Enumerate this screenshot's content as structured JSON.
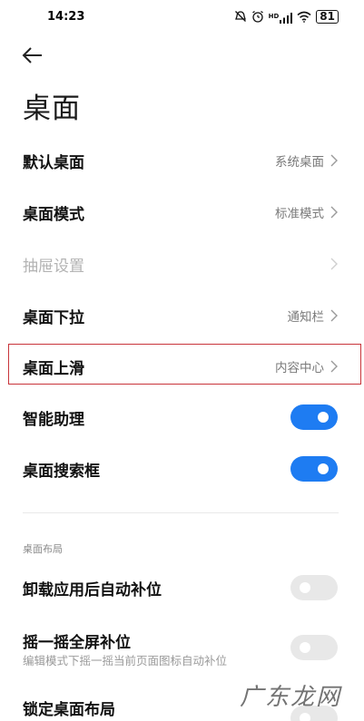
{
  "status_bar": {
    "time": "14:23",
    "icons": [
      "alarm-off-icon",
      "alarm-icon",
      "hd-signal-icon",
      "wifi-icon"
    ],
    "hd_text": "HD",
    "battery": "81"
  },
  "page": {
    "title": "桌面"
  },
  "rows": [
    {
      "label": "默认桌面",
      "value": "系统桌面"
    },
    {
      "label": "桌面模式",
      "value": "标准模式"
    },
    {
      "label": "抽屉设置",
      "value": ""
    },
    {
      "label": "桌面下拉",
      "value": "通知栏"
    },
    {
      "label": "桌面上滑",
      "value": "内容中心"
    }
  ],
  "toggles": [
    {
      "label": "智能助理",
      "state": "on"
    },
    {
      "label": "桌面搜索框",
      "state": "on"
    }
  ],
  "layout_section": {
    "header": "桌面布局",
    "items": [
      {
        "label": "卸载应用后自动补位",
        "sub": "",
        "state": "off"
      },
      {
        "label": "摇一摇全屏补位",
        "sub": "编辑模式下摇一摇当前页面图标自动补位",
        "state": "off"
      },
      {
        "label": "锁定桌面布局",
        "sub": "",
        "state": "off"
      }
    ]
  },
  "watermark": "广东龙网",
  "colors": {
    "accent": "#1e7cf2",
    "highlight": "#c8343a",
    "toggle_off": "#e8e8e8"
  }
}
